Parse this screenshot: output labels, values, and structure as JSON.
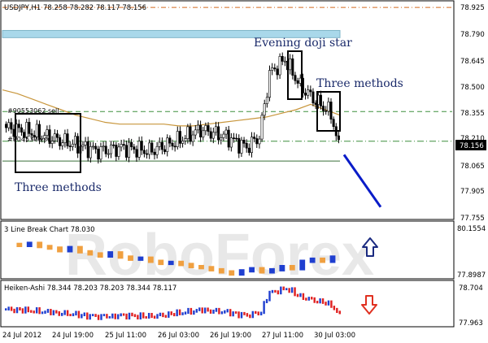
{
  "colors": {
    "background": "#ffffff",
    "panel_border": "#000000",
    "bull_candle": "#ffffff",
    "bear_candle": "#000000",
    "moving_average": "#c8963c",
    "level_line": "#3f8f3f",
    "top_level_line": "#d2691e",
    "zone_fill": "#a9d8ea",
    "forecast_arrow": "#0a1cc8",
    "lb_up": "#1f3fd0",
    "lb_down": "#f0a040",
    "ha_bull": "#1f3fd0",
    "ha_bear": "#e02020",
    "arrow_up_icon": "#1a2a80",
    "arrow_down_icon": "#e03020",
    "watermark": "#e8e8e8"
  },
  "watermark": "RoboForex",
  "chart_data": [
    {
      "type": "candlestick",
      "title": "USDJPY,H1  78.258 78.282 78.117 78.156",
      "ylim": [
        77.75,
        78.95
      ],
      "y_ticks": [
        "78.925",
        "78.790",
        "78.645",
        "78.500",
        "78.355",
        "78.210",
        "78.065",
        "77.905",
        "77.755"
      ],
      "current_price": "78.156",
      "levels": [
        {
          "label": "",
          "value": 78.918,
          "style": "dash-dot"
        },
        {
          "label": "#90553062 sell",
          "value": 78.34,
          "style": "dash"
        },
        {
          "label": "#9045376 sell",
          "value": 78.175,
          "style": "dash-dot"
        },
        {
          "label": "",
          "value": 78.065,
          "style": "solid"
        }
      ],
      "zone": [
        78.75,
        78.79
      ],
      "annotations": [
        "Evening doji star",
        "Three methods",
        "Three methods"
      ],
      "forecast": {
        "from_x": 0.705,
        "to_x": 0.78,
        "from_y": 78.1,
        "to_y": 77.81
      },
      "ma_values": [
        78.46,
        78.44,
        78.41,
        78.38,
        78.35,
        78.32,
        78.3,
        78.28,
        78.27,
        78.27,
        78.27,
        78.27,
        78.26,
        78.26,
        78.27,
        78.28,
        78.29,
        78.3,
        78.31,
        78.33,
        78.35,
        78.38,
        78.35,
        78.32
      ]
    },
    {
      "type": "bar",
      "title": "3 Line Break Chart 78.030",
      "ylim": [
        77.8987,
        80.1554
      ],
      "y_ticks": [
        "80.1554",
        "77.8987"
      ]
    },
    {
      "type": "bar",
      "title": "Heiken-Ashi 78.344 78.203 78.203 78.344 78.117",
      "ylim": [
        77.963,
        78.704
      ],
      "y_ticks": [
        "78.704",
        "77.963"
      ]
    }
  ],
  "x_ticks": [
    "24 Jul 2012",
    "24 Jul 19:00",
    "25 Jul 11:00",
    "26 Jul 03:00",
    "26 Jul 19:00",
    "27 Jul 11:00",
    "30 Jul 03:00"
  ]
}
